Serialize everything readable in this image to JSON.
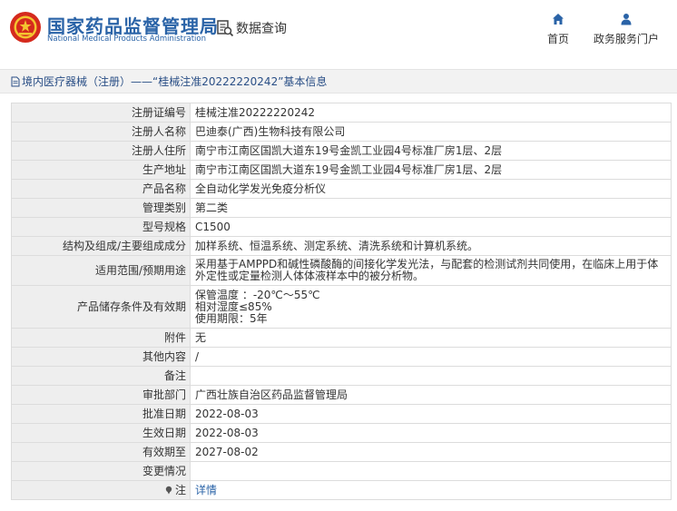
{
  "header": {
    "brand_cn": "国家药品监督管理局",
    "brand_en": "National Medical Products Administration",
    "query_label": "数据查询",
    "nav": {
      "home_label": "首页",
      "service_label": "政务服务门户"
    },
    "brand_color": "#2a63a7",
    "logo_red": "#d52a1d"
  },
  "breadcrumb": {
    "text": "境内医疗器械（注册）——“桂械注准20222220242”基本信息"
  },
  "detail": {
    "reg_no": {
      "label": "注册证编号",
      "value": "桂械注准20222220242"
    },
    "registrant": {
      "label": "注册人名称",
      "value": "巴迪泰(广西)生物科技有限公司"
    },
    "registrant_addr": {
      "label": "注册人住所",
      "value": "南宁市江南区国凯大道东19号金凯工业园4号标准厂房1层、2层"
    },
    "prod_addr": {
      "label": "生产地址",
      "value": "南宁市江南区国凯大道东19号金凯工业园4号标准厂房1层、2层"
    },
    "product_name": {
      "label": "产品名称",
      "value": "全自动化学发光免疫分析仪"
    },
    "mgmt_class": {
      "label": "管理类别",
      "value": "第二类"
    },
    "model": {
      "label": "型号规格",
      "value": "C1500"
    },
    "structure": {
      "label": "结构及组成/主要组成成分",
      "value": "加样系统、恒温系统、测定系统、清洗系统和计算机系统。"
    },
    "usage": {
      "label": "适用范围/预期用途",
      "value": "采用基于AMPPD和碱性磷酸酶的间接化学发光法，与配套的检测试剂共同使用，在临床上用于体外定性或定量检测人体体液样本中的被分析物。"
    },
    "storage": {
      "label": "产品储存条件及有效期",
      "line1": "保管温度 ：-20℃～55℃",
      "line2": "相对湿度≤85%",
      "line3": "使用期限：5年"
    },
    "attachment": {
      "label": "附件",
      "value": "无"
    },
    "other": {
      "label": "其他内容",
      "value": "/"
    },
    "remark": {
      "label": "备注",
      "value": ""
    },
    "dept": {
      "label": "审批部门",
      "value": "广西壮族自治区药品监督管理局"
    },
    "approve_date": {
      "label": "批准日期",
      "value": "2022-08-03"
    },
    "effective_date": {
      "label": "生效日期",
      "value": "2022-08-03"
    },
    "expire_date": {
      "label": "有效期至",
      "value": "2027-08-02"
    },
    "change": {
      "label": "变更情况",
      "value": ""
    },
    "note": {
      "label": "注",
      "link": "详情"
    }
  }
}
